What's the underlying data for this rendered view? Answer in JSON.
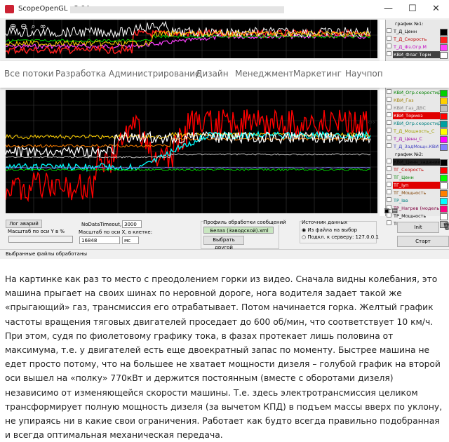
{
  "window": {
    "title": "ScopeOpenGL v2.04",
    "controls": {
      "minimize": "—",
      "maximize": "☐",
      "close": "✕"
    }
  },
  "toolbar": {
    "icons": [
      "zoom-in-icon",
      "zoom-out-icon",
      "zoom-icon",
      "binoculars-icon"
    ]
  },
  "site_nav": {
    "items": [
      "Все потоки",
      "Разработка",
      "Администрирование",
      "Дизайн",
      "Менеджмент",
      "Маркетинг",
      "Научпоп"
    ]
  },
  "legend": {
    "header1": "график №1:",
    "group1": [
      {
        "label": "Т_Д_Ценн",
        "color": "#000000",
        "text_color": "#000000"
      },
      {
        "label": "Т_Д_Скорость",
        "color": "#ff2020",
        "text_color": "#c00000"
      },
      {
        "label": "Т_Д_Фз.Огр.М",
        "color": "#ff40ff",
        "text_color": "#c000c0"
      },
      {
        "label": "КВИ_Флаг Торм",
        "color": "#ffffff",
        "text_color": "#ffffff",
        "bg": "#404040"
      }
    ],
    "group1b": [
      {
        "label": "КВИ_Огр.скоростиДВ",
        "color": "#00d000",
        "text_color": "#008000"
      },
      {
        "label": "КВИ_Газ",
        "color": "#ffd000",
        "text_color": "#a08000"
      },
      {
        "label": "КВИ_Газ_ДВС",
        "color": "#c0c0c0",
        "text_color": "#808080"
      },
      {
        "label": "КВИ_Тормоз",
        "color": "#ff0000",
        "text_color": "#ffffff",
        "bg": "#e00000"
      },
      {
        "label": "КВИ_Огр.скоростиДВ",
        "color": "#00a0a0",
        "text_color": "#008080"
      },
      {
        "label": "Т_Д_Мощность_С",
        "color": "#ffff00",
        "text_color": "#a0a000"
      },
      {
        "label": "Т_Д_Ценн_С",
        "color": "#ff00ff",
        "text_color": "#a000a0"
      },
      {
        "label": "Т_Д_ЗадМощн.КВИ",
        "color": "#8080ff",
        "text_color": "#4040c0"
      }
    ],
    "header2": "график №2:",
    "group2": [
      {
        "label": "КВИ_Ценн_задание ТГ",
        "color": "#000000",
        "text_color": "#000000",
        "bg": "#202020"
      },
      {
        "label": "ТГ_Скорость",
        "color": "#ff0000",
        "text_color": "#c00000"
      },
      {
        "label": "ТГ_Ценн",
        "color": "#00ff00",
        "text_color": "#008000"
      },
      {
        "label": "ТГ_Iуп",
        "color": "#ffffff",
        "text_color": "#ffffff",
        "bg": "#e00000"
      },
      {
        "label": "ТГ_Мощность",
        "color": "#ff8000",
        "text_color": "#804000"
      },
      {
        "label": "ТР_Iвв",
        "color": "#00ffff",
        "text_color": "#008080"
      },
      {
        "label": "ТР_Нагрев (модель)",
        "color": "#ff0080",
        "text_color": "#800040"
      },
      {
        "label": "ТР_Мощность",
        "color": "#ffffff",
        "text_color": "#000000"
      },
      {
        "label": "ТР_Ценн",
        "color": "#c0c0c0",
        "text_color": "#000000"
      }
    ]
  },
  "controls": {
    "log_button": "Лог аварий",
    "scale_y_label": "Масштаб по оси Y в %",
    "nodata_label": "NoDataTimeout, мс:",
    "nodata_value": "3000",
    "scale_x_label": "Масштаб по оси X, в клетке:",
    "scale_x_value": "16848",
    "scale_x_unit": "мс",
    "profile_group": "Профиль обработки сообщений",
    "profile_value": "Белаз (Заводской).xml",
    "choose_button": "Выбрать другой",
    "source_group": "Источник данных",
    "source_file": "Из файла на выбор",
    "source_server": "Подкл. к серверу: 127.0.0.1",
    "init_button": "Init",
    "start_button": "Старт",
    "status_text": "Выбранные файлы обработаны"
  },
  "article": {
    "paragraph": "На картинке как раз то место с преодолением горки из видео. Сначала видны колебания, это машина прыгает на своих шинах по неровной дороге, нога водителя задает такой же «прыгающий» газ, трансмиссия его отрабатывает. Потом начинается горка. Желтый график частоты вращения тяговых двигателей проседает до 600 об/мин, что соответствует 10 км/ч. При этом, судя по фиолетовому графику тока, в фазах протекает лишь половина от максимума, т.е. у двигателей есть еще двоекратный запас по моменту. Быстрее машина не едет просто потому, что на большее не хватает мощности дизеля – голубой график на второй оси вышел на «полку» 770кВт и держится постоянным (вместе с оборотами дизеля) независимо от изменяющейся скорости машины. Т.е. здесь электротрансмиссия целиком трансформирует полную мощность дизеля (за вычетом КПД) в подъем массы вверх по уклону, не упираясь ни в какие свои ограничения. Работает как будто всегда правильно подобранная и всегда оптимальная механическая передача."
  }
}
